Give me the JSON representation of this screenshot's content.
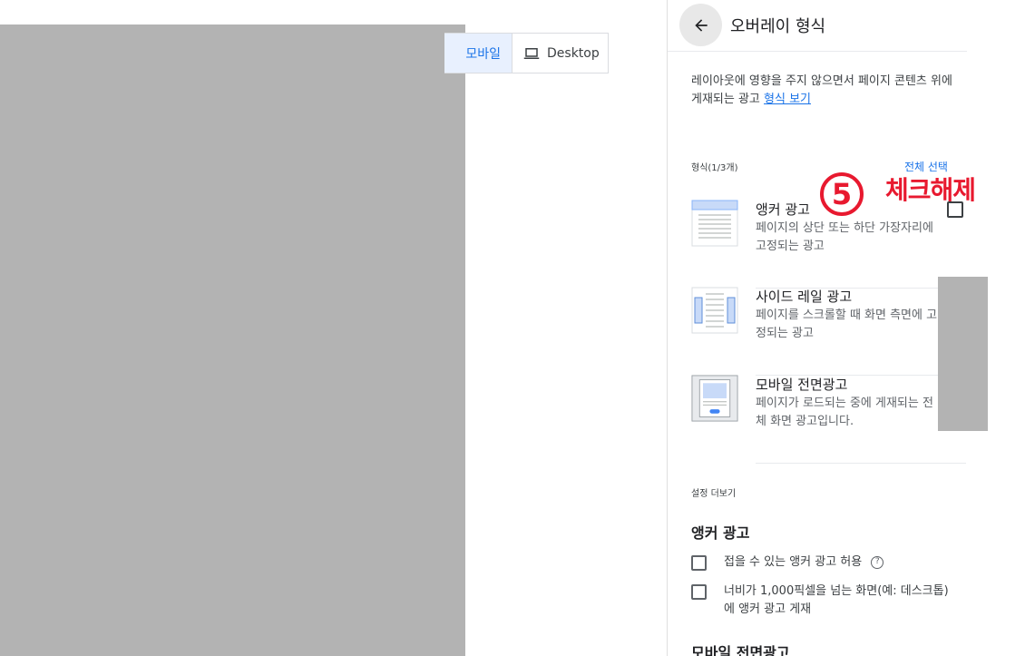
{
  "preview": {
    "tabs": {
      "mobile_label": "모바일",
      "desktop_label": "Desktop"
    }
  },
  "panel": {
    "title": "오버레이 형식",
    "description_text": "레이아웃에 영향을 주지 않으면서 페이지 콘텐츠 위에 게재되는 광고 ",
    "description_link": "형식 보기",
    "formats_count": "형식(1/3개)",
    "select_all": "전체 선택",
    "annotation": {
      "number": "5",
      "text": "체크해제"
    },
    "formats": [
      {
        "title": "앵커 광고",
        "desc": "페이지의 상단 또는 하단 가장자리에 고정되는 광고",
        "checked": false
      },
      {
        "title": "사이드 레일 광고",
        "desc": "페이지를 스크롤할 때 화면 측면에 고정되는 광고"
      },
      {
        "title": "모바일 전면광고",
        "desc": "페이지가 로드되는 중에 게재되는 전체 화면 광고입니다."
      }
    ],
    "settings_more": "설정 더보기",
    "anchor_section": {
      "title": "앵커 광고",
      "options": [
        {
          "label": "접을 수 있는 앵커 광고 허용",
          "checked": false
        },
        {
          "label": "너비가 1,000픽셀을 넘는 화면(예: 데스크톱)에 앵커 광고 게재",
          "checked": false
        }
      ]
    },
    "mobile_section_title": "모바일 전면광고"
  },
  "colors": {
    "accent": "#1a73e8",
    "annotation": "#e8192f",
    "mask": "#b3b3b3"
  },
  "icons": {
    "back": "arrow-left-icon",
    "desktop": "laptop-icon",
    "help": "help-circle-icon"
  }
}
